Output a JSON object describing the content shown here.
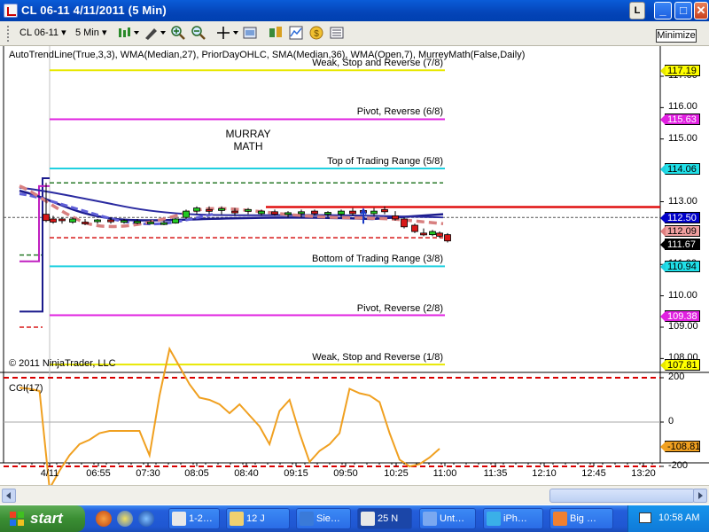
{
  "window": {
    "title": "CL 06-11  4/11/2011 (5 Min)",
    "l_button": "L",
    "min_symbol": "_",
    "max_symbol": "□",
    "close_symbol": "✕"
  },
  "toolbar": {
    "instrument": "CL 06-11",
    "interval": "5 Min",
    "minimize_label": "Minimize",
    "icons": [
      "bar-style-icon",
      "pencil-icon",
      "zoom-in-icon",
      "zoom-out-icon",
      "crosshair-icon",
      "properties-icon",
      "strategy-icon",
      "indicator-icon",
      "money-icon",
      "data-box-icon"
    ]
  },
  "chart": {
    "indicators_line": "AutoTrendLine(True,3,3), WMA(Median,27), PriorDayOHLC, SMA(Median,36), WMA(Open,7), MurreyMath(False,Daily)",
    "murray_label_line1": "MURRAY",
    "murray_label_line2": "MATH",
    "copyright": "© 2011 NinjaTrader, LLC",
    "cci_label": "CCI(17)",
    "murray_levels": [
      {
        "label": "Weak, Stop and Reverse (7/8)",
        "price": 117.19,
        "color": "#e8e800"
      },
      {
        "label": "Pivot, Reverse (6/8)",
        "price": 115.63,
        "color": "#e020e0"
      },
      {
        "label": "Top of Trading Range (5/8)",
        "price": 114.06,
        "color": "#20d0e0"
      },
      {
        "label": "Bottom of Trading Range (3/8)",
        "price": 110.94,
        "color": "#20d0e0"
      },
      {
        "label": "Pivot, Reverse (2/8)",
        "price": 109.38,
        "color": "#e020e0"
      },
      {
        "label": "Weak, Stop and Reverse (1/8)",
        "price": 107.81,
        "color": "#e8e800"
      }
    ],
    "price_axis": [
      "117.00",
      "116.00",
      "115.00",
      "113.00",
      "111.00",
      "110.00",
      "109.00",
      "108.00"
    ],
    "price_markers": [
      {
        "value": "117.19",
        "bg": "#ffff00",
        "arrow": "#e8e800"
      },
      {
        "value": "115.63",
        "bg": "#e020e0",
        "arrow": "#e020e0"
      },
      {
        "value": "114.06",
        "bg": "#20e0e8",
        "arrow": "#20d0e0"
      },
      {
        "value": "112.50",
        "bg": "#0000c8",
        "arrow": "#0000c8"
      },
      {
        "value": "112.09",
        "bg": "#f0a0a0",
        "arrow": "#e08080"
      },
      {
        "value": "111.67",
        "bg": "#000000",
        "arrow": "#000000"
      },
      {
        "value": "110.94",
        "bg": "#20e0e8",
        "arrow": "#20d0e0"
      },
      {
        "value": "109.38",
        "bg": "#e020e0",
        "arrow": "#e020e0"
      },
      {
        "value": "107.81",
        "bg": "#ffff00",
        "arrow": "#e8e800"
      }
    ],
    "cci_axis": [
      "200",
      "0",
      "-200"
    ],
    "cci_marker": {
      "value": "-108.81",
      "bg": "#f0a020"
    },
    "time_labels": [
      "4/11",
      "06:55",
      "07:30",
      "08:05",
      "08:40",
      "09:15",
      "09:50",
      "10:25",
      "11:00",
      "11:35",
      "12:10",
      "12:45",
      "13:20"
    ],
    "cci_values": [
      155,
      150,
      140,
      -300,
      -220,
      -150,
      -100,
      -80,
      -50,
      -40,
      -40,
      -40,
      -40,
      -150,
      120,
      330,
      250,
      170,
      110,
      100,
      80,
      40,
      80,
      30,
      -20,
      -100,
      50,
      100,
      -50,
      -180,
      -130,
      -100,
      -50,
      150,
      130,
      120,
      90,
      -50,
      -170,
      -200,
      -190,
      -160,
      -120
    ],
    "colors": {
      "up": "#22c822",
      "down": "#d81818",
      "cci_line": "#f0a020",
      "cci_band": "#d80000",
      "trend_blue": "#1a1a8c",
      "wma": "#d88080"
    }
  },
  "taskbar": {
    "start_label": "start",
    "clock": "10:58 AM",
    "tasks": [
      {
        "label": "1-2…",
        "icon": "app-icon"
      },
      {
        "label": "12 J",
        "icon": "folder-icon"
      },
      {
        "label": "Sie…",
        "icon": "globe-icon"
      },
      {
        "label": "25 N",
        "icon": "clock-icon"
      },
      {
        "label": "Unt…",
        "icon": "document-icon"
      },
      {
        "label": "iPh…",
        "icon": "phone-icon"
      },
      {
        "label": "Big …",
        "icon": "firefox-icon"
      }
    ]
  }
}
